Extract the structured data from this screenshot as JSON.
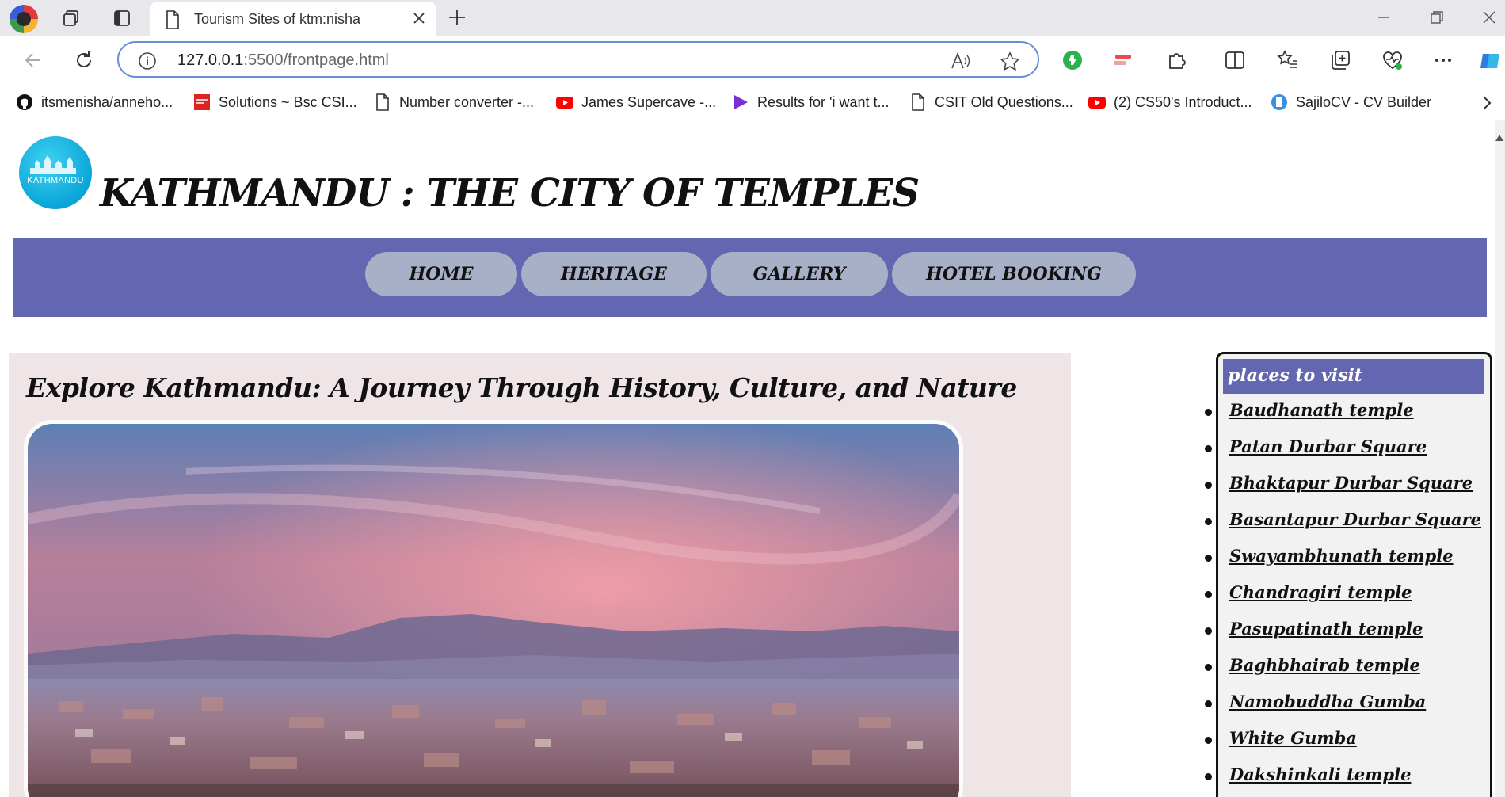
{
  "browser": {
    "tab_title": "Tourism Sites of ktm:nisha",
    "url_host": "127.0.0.1",
    "url_path": ":5500/frontpage.html",
    "bookmarks": [
      {
        "label": "itsmenisha/anneho...",
        "icon": "github-icon"
      },
      {
        "label": "Solutions ~ Bsc CSI...",
        "icon": "site-icon"
      },
      {
        "label": "Number converter -...",
        "icon": "page-icon"
      },
      {
        "label": "James Supercave -...",
        "icon": "youtube-icon"
      },
      {
        "label": "Results for 'i want t...",
        "icon": "play-icon"
      },
      {
        "label": "CSIT Old Questions...",
        "icon": "page-icon"
      },
      {
        "label": "(2) CS50's Introduct...",
        "icon": "youtube-icon"
      },
      {
        "label": "SajiloCV - CV Builder",
        "icon": "cv-icon"
      }
    ]
  },
  "site": {
    "logo_text": "KATHMANDU",
    "title": "KATHMANDU : THE CITY OF TEMPLES",
    "nav": [
      "HOME",
      "HERITAGE",
      "GALLERY",
      "HOTEL BOOKING"
    ],
    "headline": "Explore Kathmandu: A Journey Through History, Culture, and Nature",
    "sidebar_heading": "places to visit",
    "places": [
      "Baudhanath temple",
      "Patan Durbar Square",
      "Bhaktapur Durbar Square",
      "Basantapur Durbar Square",
      "Swayambhunath temple",
      "Chandragiri temple",
      "Pasupatinath temple",
      "Baghbhairab temple",
      "Namobuddha Gumba",
      "White Gumba",
      "Dakshinkali temple"
    ]
  },
  "colors": {
    "nav_band": "#6366b0",
    "nav_pill": "#a8b0c8",
    "content_bg": "#efe5e7",
    "omnibox_border": "#6b8fd6"
  }
}
